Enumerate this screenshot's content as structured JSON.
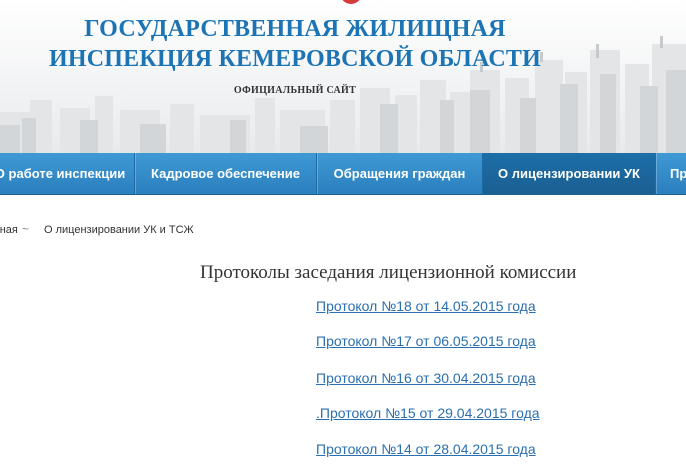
{
  "header": {
    "title_line1": "ГОСУДАРСТВЕННАЯ ЖИЛИЩНАЯ",
    "title_line2": "ИНСПЕКЦИЯ КЕМЕРОВСКОЙ ОБЛАСТИ",
    "subtitle": "ОФИЦИАЛЬНЫЙ САЙТ"
  },
  "nav": {
    "items": [
      {
        "label": "О работе инспекции"
      },
      {
        "label": "Кадровое обеспечение"
      },
      {
        "label": "Обращения граждан"
      },
      {
        "label": "О лицензировании УК"
      },
      {
        "label": "Пр"
      }
    ],
    "active_index": 3
  },
  "breadcrumb": {
    "home": "Главная",
    "separator_icon": "wave-icon",
    "current": "О лицензировании УК и ТСЖ"
  },
  "main": {
    "title": "Протоколы заседания лицензионной комиссии",
    "documents": [
      {
        "label": "Протокол №18 от 14.05.2015 года"
      },
      {
        "label": "Протокол №17 от 06.05.2015 года"
      },
      {
        "label": "Протокол №16 от 30.04.2015 года"
      },
      {
        "label": ".Протокол №15 от 29.04.2015 года"
      },
      {
        "label": "Протокол №14 от 28.04.2015 года"
      }
    ]
  },
  "colors": {
    "title_blue": "#1d74b4",
    "nav_blue": "#2f8bc8",
    "nav_active": "#1d6ea8",
    "link_blue": "#2a6fb0"
  }
}
